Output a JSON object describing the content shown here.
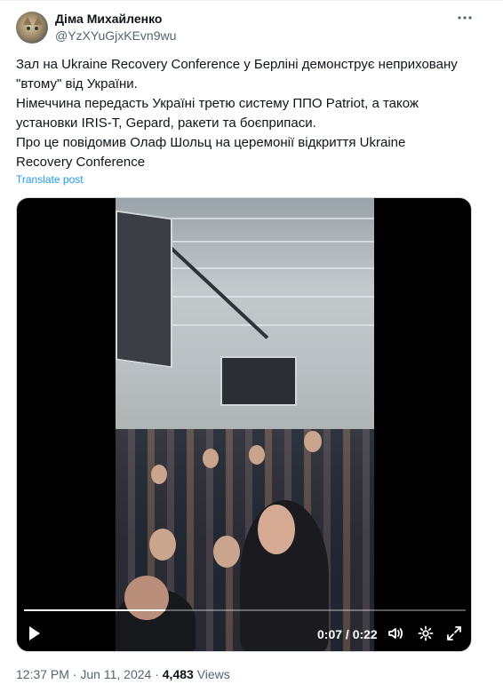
{
  "author": {
    "name": "Діма Михайленко",
    "handle": "@YzXYuGjxKEvn9wu",
    "avatar_icon": "cat-avatar"
  },
  "menu_icon": "more-horizontal-icon",
  "tweet": {
    "lines": [
      "Зал на Ukraine Recovery Conference у Берліні демонструє неприховану",
      "\"втому\" від України.",
      "Німеччина передасть Україні третю систему ППО Patriot, а також",
      "установки IRIS-T, Gepard, ракети та боєприпаси.",
      "Про це повідомив Олаф Шольц на церемонії відкриття Ukraine",
      "Recovery Conference"
    ],
    "translate_label": "Translate post"
  },
  "video": {
    "elapsed": "0:07",
    "duration": "0:22",
    "time_display": "0:07 / 0:22",
    "progress_fraction": 0.32,
    "controls": [
      "play-icon",
      "volume-icon",
      "settings-icon",
      "fullscreen-icon"
    ]
  },
  "footer": {
    "time": "12:37 PM",
    "separator": " · ",
    "date": "Jun 11, 2024",
    "views_count": "4,483",
    "views_label": "Views"
  },
  "colors": {
    "link": "#1d9bf0",
    "secondary_text": "#536471",
    "primary_text": "#0f1419"
  }
}
